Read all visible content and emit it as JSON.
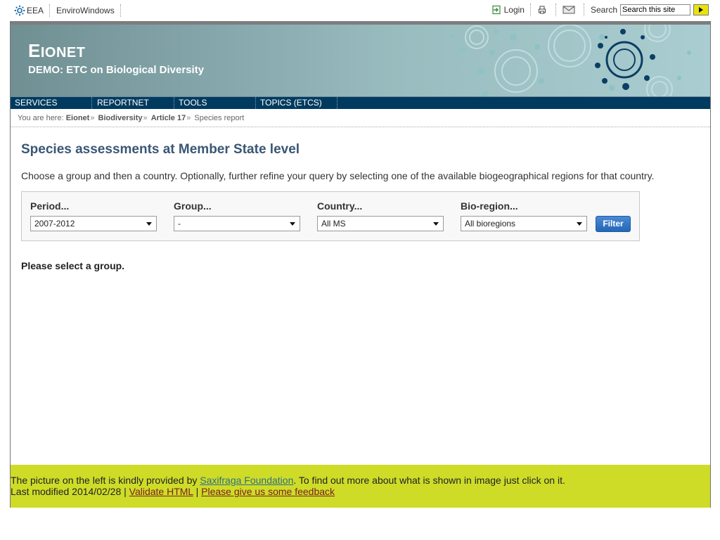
{
  "topbar": {
    "eea_label": "EEA",
    "envirowindows_label": "EnviroWindows",
    "login_label": "Login",
    "search_label": "Search",
    "search_placeholder": "Search this site"
  },
  "banner": {
    "title_cap": "E",
    "title_rest": "IONET",
    "subtitle": "DEMO: ETC on Biological Diversity"
  },
  "nav": {
    "items": [
      {
        "label": "SERVICES"
      },
      {
        "label": "REPORTNET"
      },
      {
        "label": "TOOLS"
      },
      {
        "label": "TOPICS (ETCS)"
      }
    ]
  },
  "breadcrumb": {
    "prefix": "You are here:",
    "items": [
      "Eionet",
      "Biodiversity",
      "Article 17"
    ],
    "current": "Species report"
  },
  "main": {
    "heading": "Species assessments at Member State level",
    "intro": "Choose a group and then a country. Optionally, further refine your query by selecting one of the available biogeographical regions for that country.",
    "filters": [
      {
        "label": "Period...",
        "value": "2007-2012"
      },
      {
        "label": "Group...",
        "value": "-"
      },
      {
        "label": "Country...",
        "value": "All MS"
      },
      {
        "label": "Bio-region...",
        "value": "All bioregions"
      }
    ],
    "filter_button": "Filter",
    "message": "Please select a group."
  },
  "footer": {
    "line1_prefix": "The picture on the left is kindly provided by ",
    "line1_link": "Saxifraga Foundation",
    "line1_suffix": ". To find out more about what is shown in image just click on it.",
    "line2_prefix": "Last modified 2014/02/28 | ",
    "validate_link": "Validate HTML",
    "separator": " | ",
    "feedback_link": "Please give us some feedback"
  },
  "colors": {
    "nav_bg": "#003b5f",
    "heading": "#3a5675",
    "footer_bg": "#cedc28",
    "filter_button": "#2467b7"
  }
}
